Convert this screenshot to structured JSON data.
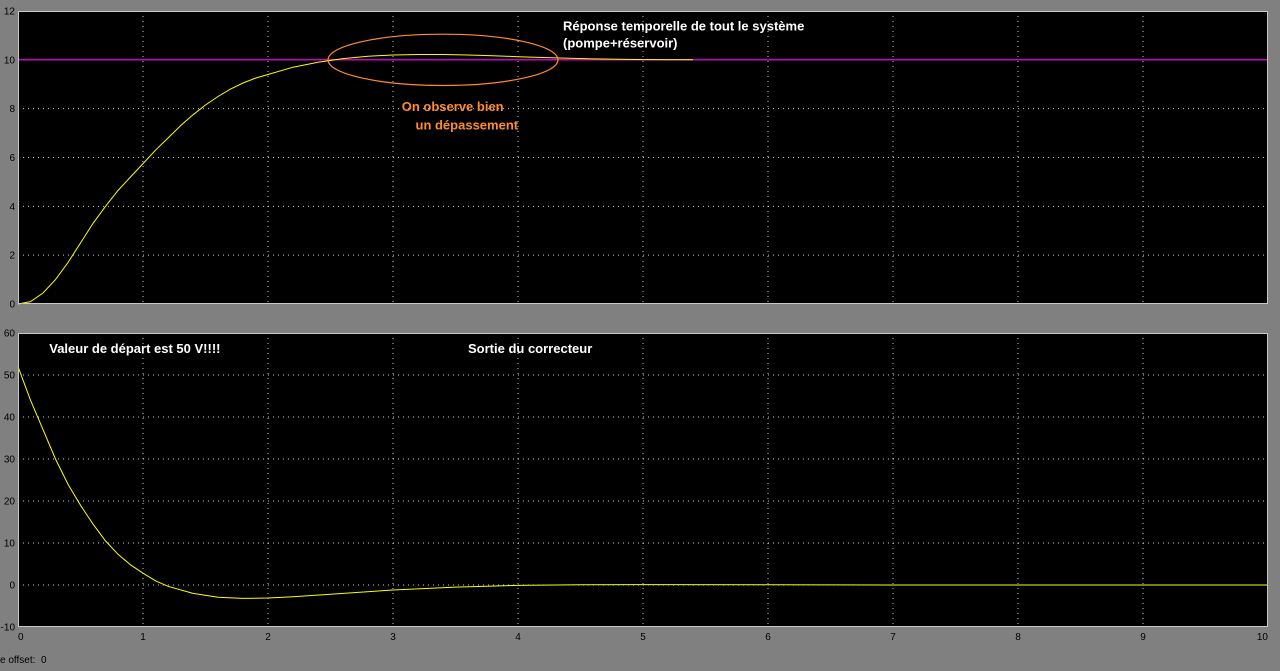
{
  "colors": {
    "background": "#808080",
    "plot_bg": "#000000",
    "grid": "#ffffff",
    "signal": "#ffff00",
    "setpoint": "#cc00cc",
    "annotation_white": "#ffffff",
    "annotation_orange": "#ff8c2e"
  },
  "footer": {
    "label": "e offset:",
    "value": "0"
  },
  "chart_data": [
    {
      "type": "line",
      "xlim": [
        0,
        10
      ],
      "ylim": [
        0,
        12
      ],
      "x_ticks": [
        0,
        1,
        2,
        3,
        4,
        5,
        6,
        7,
        8,
        9,
        10
      ],
      "y_ticks": [
        0,
        2,
        4,
        6,
        8,
        10,
        12
      ],
      "x_tick_labels_shown": false,
      "grid": true,
      "annotations": [
        {
          "text": "Réponse temporelle de tout le système",
          "x": 4.36,
          "y": 11.2,
          "color": "white"
        },
        {
          "text": "(pompe+réservoir)",
          "x": 4.36,
          "y": 10.5,
          "color": "white"
        },
        {
          "text": "On observe bien",
          "x": 3.07,
          "y": 7.9,
          "color": "orange"
        },
        {
          "text": "un dépassement",
          "x": 3.18,
          "y": 7.15,
          "color": "orange"
        }
      ],
      "highlight_ellipse": {
        "cx": 3.4,
        "cy": 10.0,
        "rx": 0.92,
        "ry": 1.05,
        "color": "orange"
      },
      "series": [
        {
          "color": "setpoint",
          "x": [
            0,
            10
          ],
          "y": [
            10,
            10
          ]
        },
        {
          "color": "signal",
          "x": [
            0,
            0.1,
            0.2,
            0.3,
            0.4,
            0.5,
            0.6,
            0.7,
            0.8,
            0.9,
            1.0,
            1.1,
            1.2,
            1.3,
            1.4,
            1.5,
            1.6,
            1.7,
            1.8,
            1.9,
            2.0,
            2.2,
            2.4,
            2.6,
            2.8,
            3.0,
            3.2,
            3.4,
            3.6,
            3.8,
            4.0,
            4.3,
            4.6,
            5.0,
            5.4
          ],
          "y": [
            0,
            0.1,
            0.45,
            1.0,
            1.7,
            2.5,
            3.3,
            4.0,
            4.65,
            5.2,
            5.75,
            6.3,
            6.8,
            7.3,
            7.75,
            8.15,
            8.5,
            8.8,
            9.05,
            9.25,
            9.4,
            9.7,
            9.9,
            10.05,
            10.15,
            10.2,
            10.22,
            10.22,
            10.2,
            10.17,
            10.13,
            10.08,
            10.04,
            10.01,
            10.0
          ]
        }
      ]
    },
    {
      "type": "line",
      "xlim": [
        0,
        10
      ],
      "ylim": [
        -10,
        60
      ],
      "x_ticks": [
        0,
        1,
        2,
        3,
        4,
        5,
        6,
        7,
        8,
        9,
        10
      ],
      "y_ticks": [
        -10,
        0,
        10,
        20,
        30,
        40,
        50,
        60
      ],
      "x_tick_labels_shown": true,
      "grid": true,
      "annotations": [
        {
          "text": "Valeur de départ est 50 V!!!!",
          "x": 0.25,
          "y": 55.2,
          "color": "white"
        },
        {
          "text": "Sortie du correcteur",
          "x": 3.6,
          "y": 55.2,
          "color": "white"
        }
      ],
      "series": [
        {
          "color": "signal",
          "x": [
            0,
            0.1,
            0.2,
            0.3,
            0.4,
            0.5,
            0.6,
            0.7,
            0.8,
            0.9,
            1.0,
            1.1,
            1.2,
            1.4,
            1.6,
            1.8,
            2.0,
            2.2,
            2.5,
            3.0,
            3.5,
            4.0,
            4.5,
            5.0,
            6.0,
            7.0,
            8.0,
            9.0,
            10.0
          ],
          "y": [
            52,
            44,
            37,
            30,
            24,
            19,
            14.5,
            10.5,
            7.3,
            4.8,
            2.8,
            1.0,
            -0.3,
            -2.0,
            -2.9,
            -3.2,
            -3.1,
            -2.8,
            -2.2,
            -1.2,
            -0.5,
            -0.1,
            0.05,
            0.1,
            0.05,
            0.0,
            0.0,
            0.0,
            0.0
          ]
        }
      ]
    }
  ]
}
